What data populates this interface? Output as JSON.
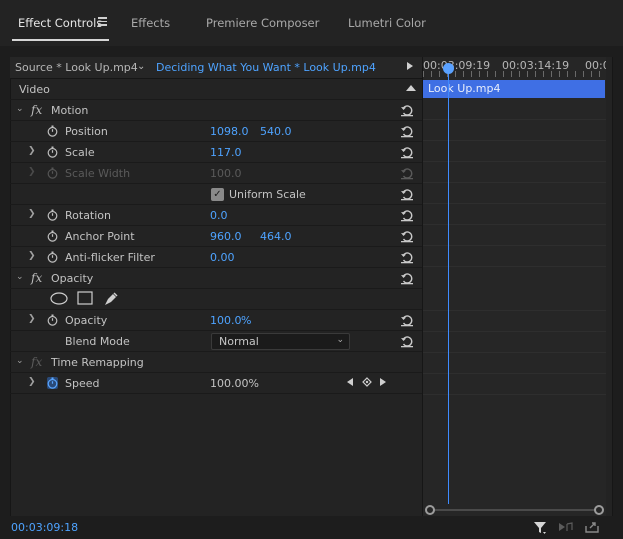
{
  "tabs": [
    {
      "label": "Effect Controls",
      "active": true
    },
    {
      "label": "Effects"
    },
    {
      "label": "Premiere Composer"
    },
    {
      "label": "Lumetri Color"
    }
  ],
  "source": {
    "label": "Source * Look Up.mp4",
    "clip": "Deciding What You Want * Look Up.mp4"
  },
  "ruler": {
    "tick_labels": [
      "00:03:09:19",
      "00:03:14:19",
      "00:0"
    ]
  },
  "clip_bar": {
    "label": "Look Up.mp4",
    "color": "#3f6fe4"
  },
  "section": {
    "video": "Video"
  },
  "motion": {
    "name": "Motion",
    "position": {
      "label": "Position",
      "x": "1098.0",
      "y": "540.0"
    },
    "scale": {
      "label": "Scale",
      "value": "117.0"
    },
    "scale_width": {
      "label": "Scale Width",
      "value": "100.0"
    },
    "uniform_scale": {
      "label": "Uniform Scale",
      "checked": true
    },
    "rotation": {
      "label": "Rotation",
      "value": "0.0"
    },
    "anchor_point": {
      "label": "Anchor Point",
      "x": "960.0",
      "y": "464.0"
    },
    "anti_flicker": {
      "label": "Anti-flicker Filter",
      "value": "0.00"
    }
  },
  "opacity": {
    "name": "Opacity",
    "opacity": {
      "label": "Opacity",
      "value": "100.0",
      "unit": "%"
    },
    "blend_mode": {
      "label": "Blend Mode",
      "value": "Normal"
    }
  },
  "time_remapping": {
    "name": "Time Remapping",
    "speed": {
      "label": "Speed",
      "value": "100.00%"
    }
  },
  "footer": {
    "timecode": "00:03:09:18"
  },
  "colors": {
    "accent": "#4ea3ff",
    "clip": "#3f6fe4",
    "background": "#232323"
  }
}
